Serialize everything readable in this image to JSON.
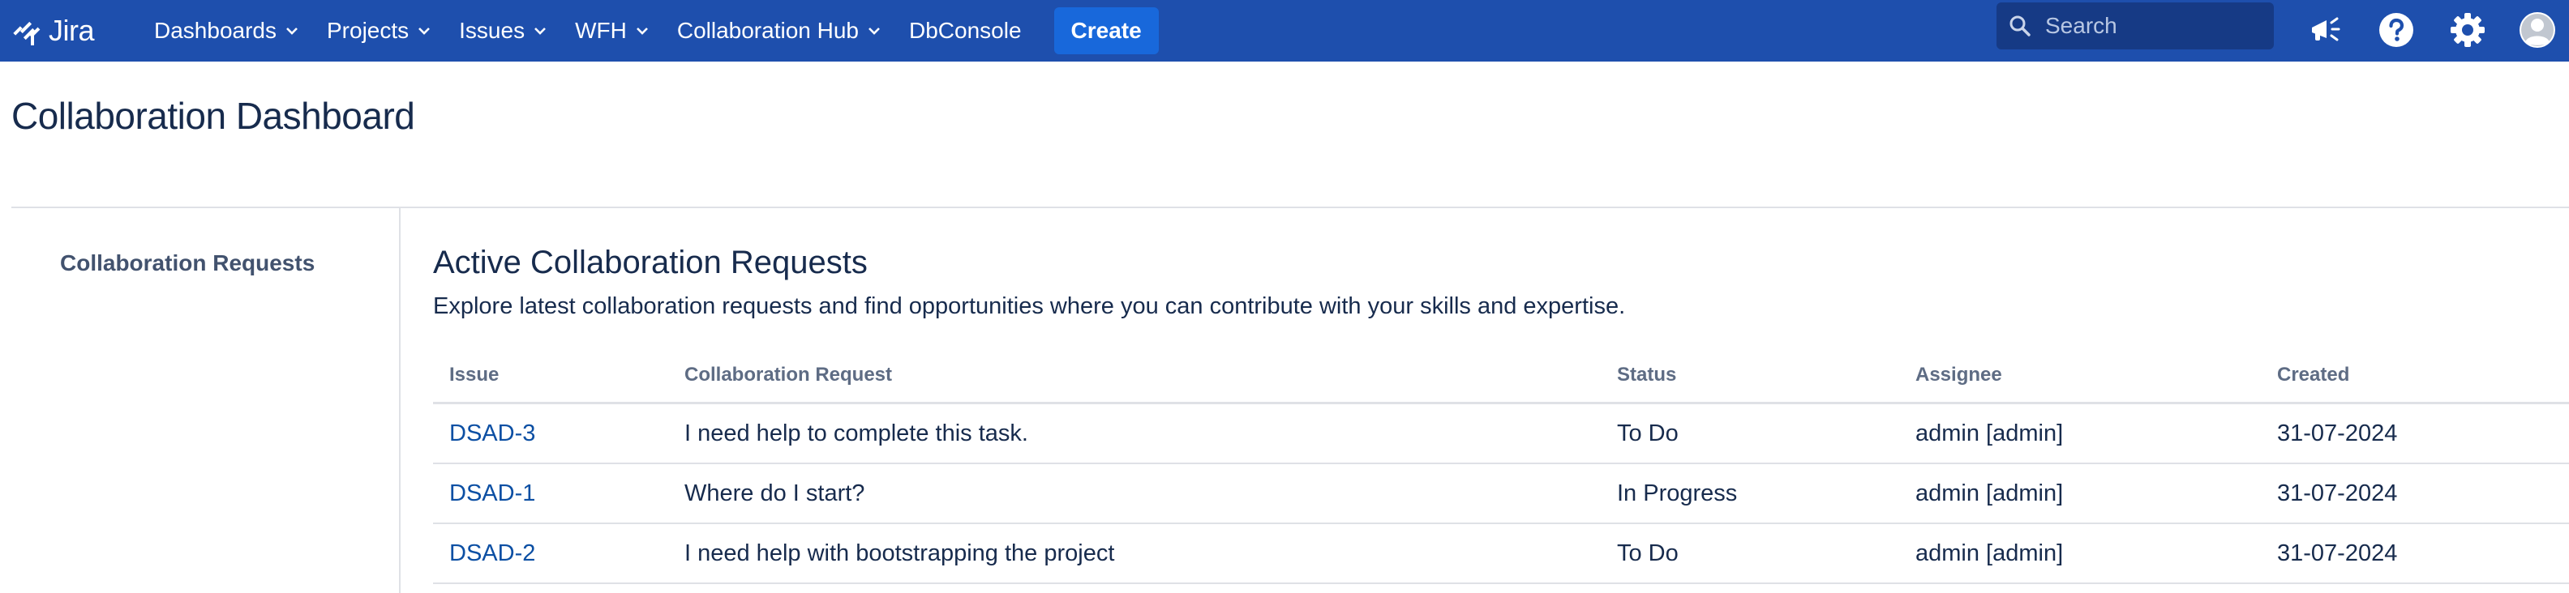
{
  "app": {
    "name": "Jira"
  },
  "nav": {
    "items": [
      {
        "label": "Dashboards",
        "has_dropdown": true
      },
      {
        "label": "Projects",
        "has_dropdown": true
      },
      {
        "label": "Issues",
        "has_dropdown": true
      },
      {
        "label": "WFH",
        "has_dropdown": true
      },
      {
        "label": "Collaboration Hub",
        "has_dropdown": true
      },
      {
        "label": "DbConsole",
        "has_dropdown": false
      }
    ],
    "create_label": "Create",
    "search_placeholder": "Search",
    "icons": [
      "megaphone-icon",
      "help-icon",
      "gear-icon",
      "avatar"
    ]
  },
  "colors": {
    "topbar": "#1e4fad",
    "create_button": "#1868db",
    "link": "#0c4fa3"
  },
  "page": {
    "title": "Collaboration Dashboard"
  },
  "sidebar": {
    "items": [
      {
        "label": "Collaboration Requests"
      }
    ]
  },
  "main": {
    "title": "Active Collaboration Requests",
    "description": "Explore latest collaboration requests and find opportunities where you can contribute with your skills and expertise.",
    "table": {
      "headers": [
        "Issue",
        "Collaboration Request",
        "Status",
        "Assignee",
        "Created"
      ],
      "rows": [
        {
          "issue": "DSAD-3",
          "request": "I need help to complete this task.",
          "status": "To Do",
          "assignee": "admin [admin]",
          "created": "31-07-2024"
        },
        {
          "issue": "DSAD-1",
          "request": "Where do I start?",
          "status": "In Progress",
          "assignee": "admin [admin]",
          "created": "31-07-2024"
        },
        {
          "issue": "DSAD-2",
          "request": "I need help with bootstrapping the project",
          "status": "To Do",
          "assignee": "admin [admin]",
          "created": "31-07-2024"
        }
      ]
    }
  }
}
